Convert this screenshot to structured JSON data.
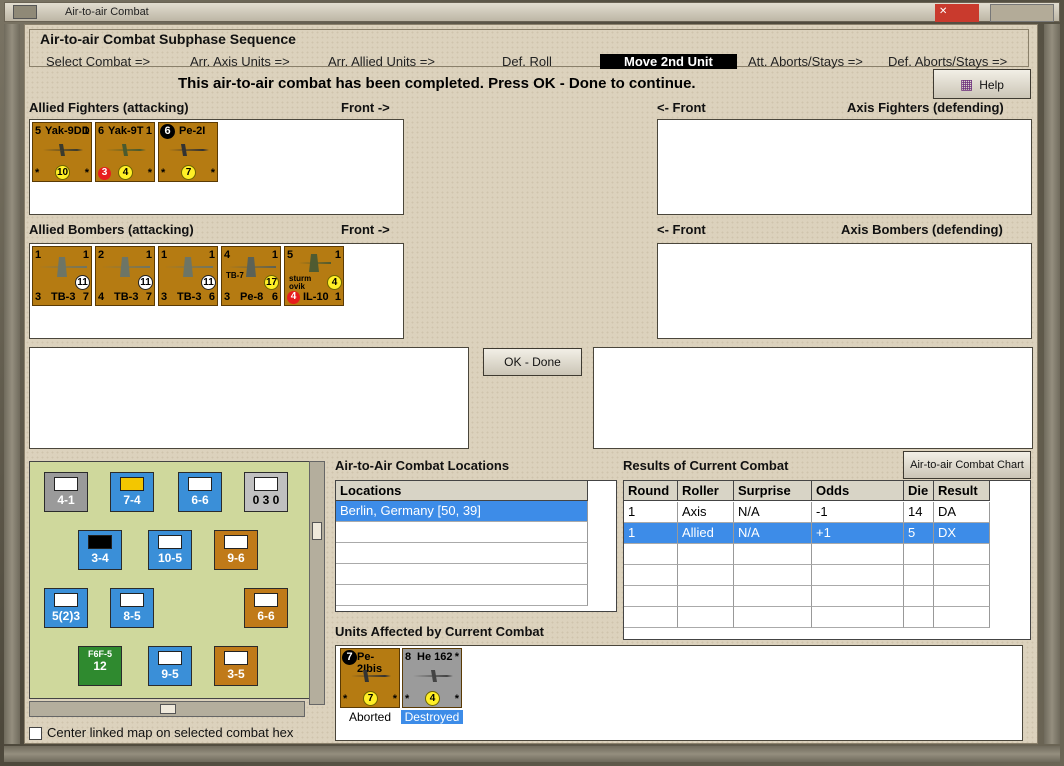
{
  "window": {
    "title": "Air-to-air Combat",
    "close_glyph": "✕"
  },
  "subphase": {
    "title": "Air-to-air Combat Subphase Sequence",
    "steps": [
      "Select Combat =>",
      "Arr. Axis Units =>",
      "Arr. Allied Units =>",
      "Def. Roll",
      "Move 2nd Unit",
      "Att. Aborts/Stays =>",
      "Def. Aborts/Stays =>"
    ],
    "active_step": "Move 2nd Unit"
  },
  "message": "This air-to-air combat has been completed.  Press OK - Done to continue.",
  "help_label": "Help",
  "sections": {
    "allied_fighters": "Allied Fighters (attacking)",
    "allied_fighters_front": "Front ->",
    "axis_fighters": "Axis Fighters (defending)",
    "axis_fighters_front": "<- Front",
    "allied_bombers": "Allied Bombers (attacking)",
    "allied_bombers_front": "Front ->",
    "axis_bombers": "Axis Bombers (defending)",
    "axis_bombers_front": "<- Front"
  },
  "fighters": [
    {
      "top_left": "5",
      "name": "Yak-9DD",
      "top_right": "1",
      "bottom_left": "*",
      "bottom_right": "*",
      "attack": "10"
    },
    {
      "top_left": "6",
      "name": "Yak-9T",
      "top_right": "1",
      "bottom_left": "*",
      "bottom_right": "*",
      "red": "3",
      "attack": "4"
    },
    {
      "top_left": "6",
      "name": "Pe-2I",
      "top_right": "1",
      "bottom_left": "*",
      "bottom_right": "*",
      "attack": "7"
    }
  ],
  "bombers": [
    {
      "top_left": "1",
      "top_right": "1",
      "name": "TB-3",
      "bottom_left": "3",
      "bottom_right": "7",
      "white": "11"
    },
    {
      "top_left": "2",
      "top_right": "1",
      "name": "TB-3",
      "bottom_left": "4",
      "bottom_right": "7",
      "white": "11"
    },
    {
      "top_left": "1",
      "top_right": "1",
      "name": "TB-3",
      "bottom_left": "3",
      "bottom_right": "6",
      "white": "11"
    },
    {
      "top_left": "4",
      "top_right": "1",
      "name": "Pe-8",
      "mark": "TB-7",
      "bottom_left": "3",
      "bottom_right": "6",
      "yellow": "17"
    },
    {
      "top_left": "5",
      "top_right": "1",
      "name": "IL-10",
      "mark": "sturm ovik",
      "bottom_left": "",
      "bottom_right": "1",
      "red": "4",
      "yellow": "4"
    }
  ],
  "ok_button": "OK - Done",
  "locations": {
    "title": "Air-to-Air Combat Locations",
    "header": "Locations",
    "rows": [
      "Berlin, Germany [50, 39]"
    ]
  },
  "results": {
    "title": "Results of Current Combat",
    "chart_button": "Air-to-air Combat Chart",
    "columns": [
      "Round",
      "Roller",
      "Surprise",
      "Odds",
      "Die",
      "Result"
    ],
    "rows": [
      [
        "1",
        "Axis",
        "N/A",
        "-1",
        "14",
        "DA"
      ],
      [
        "1",
        "Allied",
        "N/A",
        "+1",
        "5",
        "DX"
      ]
    ]
  },
  "affected": {
    "title": "Units Affected by Current Combat",
    "units": [
      {
        "top_left": "7",
        "name": "Pe-2Ibis",
        "top_right": "*",
        "bottom_left": "*",
        "bottom_right": "*",
        "attack": "7",
        "status": "Aborted"
      },
      {
        "top_left": "8",
        "name": "He 162",
        "top_right": "*",
        "bottom_left": "*",
        "bottom_right": "*",
        "attack": "4",
        "status": "Destroyed"
      }
    ]
  },
  "map": {
    "counters": [
      {
        "type": "XXX",
        "value": "4-1"
      },
      {
        "type": "XX",
        "value": "7-4"
      },
      {
        "type": "XXX",
        "value": "6-6"
      },
      {
        "type": "",
        "value": "0 3 0"
      },
      {
        "type": "XXX",
        "value": "10-5"
      },
      {
        "type": "XXXX",
        "value": "9-6"
      },
      {
        "type": "",
        "value": "3-4"
      },
      {
        "type": "XXXX",
        "value": "5(2)3"
      },
      {
        "type": "XXX",
        "value": "8-5"
      },
      {
        "type": "XX",
        "value": "6-6"
      },
      {
        "type": "XXX",
        "value": "9-5"
      },
      {
        "type": "XX",
        "value": "3-5"
      },
      {
        "type": "F6F-5",
        "value": "12"
      }
    ]
  },
  "center_map_label": "Center linked map on selected combat hex",
  "colors": {
    "counter_allied": "#b57b12",
    "counter_axis": "#9b9b9b",
    "highlight": "#3d8ce8",
    "map_blue": "#3a8fd8",
    "map_orange": "#c07a19",
    "map_green": "#2f8a2f"
  }
}
